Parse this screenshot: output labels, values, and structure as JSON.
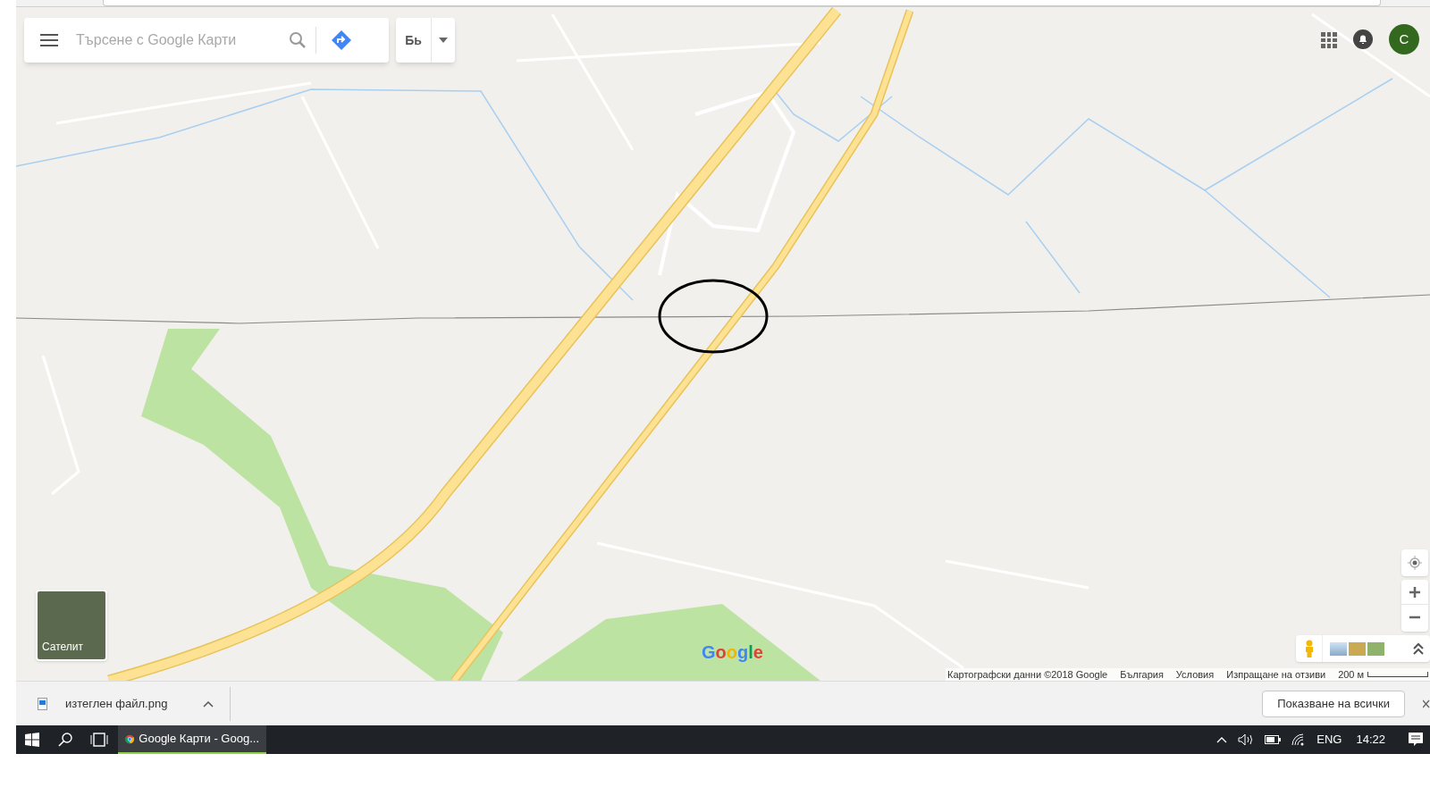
{
  "search": {
    "placeholder": "Търсене с Google Карти"
  },
  "language_button": "Бь",
  "account_initial": "C",
  "satellite_toggle": "Сателит",
  "logo": "Google",
  "footer_links": [
    "Картографски данни ©2018 Google",
    "България",
    "Условия",
    "Изпращане на отзиви"
  ],
  "scale_label": "200 м",
  "download": {
    "file": "изтеглен файл.png",
    "show_all": "Показване на всички"
  },
  "taskbar": {
    "app": "Google Карти - Goog...",
    "language": "ENG",
    "time": "14:22"
  }
}
